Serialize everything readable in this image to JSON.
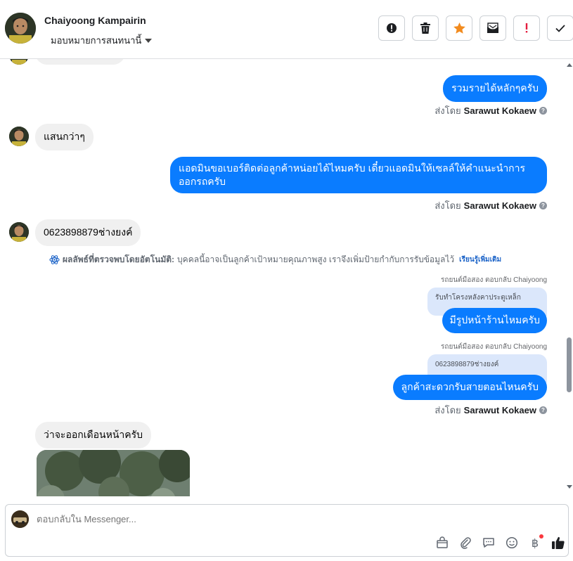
{
  "header": {
    "contact_name": "Chaiyoong Kampairin",
    "assign_label": "มอบหมายการสนทนานี้",
    "actions": [
      {
        "name": "mark-spam-button",
        "icon": "alert-circle-icon"
      },
      {
        "name": "delete-button",
        "icon": "trash-icon"
      },
      {
        "name": "star-button",
        "icon": "star-icon"
      },
      {
        "name": "mark-unread-button",
        "icon": "envelope-icon"
      },
      {
        "name": "follow-up-button",
        "icon": "exclamation-icon"
      },
      {
        "name": "mark-done-button",
        "icon": "check-icon"
      }
    ]
  },
  "messages": {
    "m1_out": "รวมรายได้หลักๆครับ",
    "m2_in": "แสนกว่าๆ",
    "m3_out": "แอดมินขอเบอร์ติดต่อลูกค้าหน่อยได้ไหมครับ เดี๋ยวแอดมินให้เซลล์ให้คำแนะนำการออกรถครับ",
    "m4_in": "0623898879ช่างยงค์",
    "m5_reply_to": "รถยนต์มือสอง ตอบกลับ Chaiyoong",
    "m5_quote": "รับทำโครงหลังคาประตูเหล็ก",
    "m5_out": "มีรูปหน้าร้านไหมครับ",
    "m6_reply_to": "รถยนต์มือสอง ตอบกลับ Chaiyoong",
    "m6_quote": "0623898879ช่างยงค์",
    "m6_out": "ลูกค้าสะดวกรับสายตอนไหนครับ",
    "m7_in": "ว่าจะออกเดือนหน้าครับ"
  },
  "sent_by": {
    "prefix": "ส่งโดย",
    "agent": "Sarawut Kokaew"
  },
  "auto_detect": {
    "title": "ผลลัพธ์ที่ตรวจพบโดยอัตโนมัติ:",
    "text": "บุคคลนี้อาจเป็นลูกค้าเป้าหมายคุณภาพสูง เราจึงเพิ่มป้ายกำกับการรับข้อมูลไว้",
    "link": "เรียนรู้เพิ่มเติม"
  },
  "composer": {
    "placeholder": "ตอบกลับใน Messenger...",
    "tools": [
      "shopping-bag-icon",
      "paperclip-icon",
      "chat-bubble-icon",
      "smiley-icon",
      "baht-icon",
      "thumbs-up-icon"
    ]
  },
  "colors": {
    "outgoing": "#0a7cff",
    "incoming": "#f0f0f0",
    "quote": "#dbe7fb",
    "star": "#f28b1e",
    "follow_up": "#e41e3f",
    "like": "#1c1e21"
  }
}
